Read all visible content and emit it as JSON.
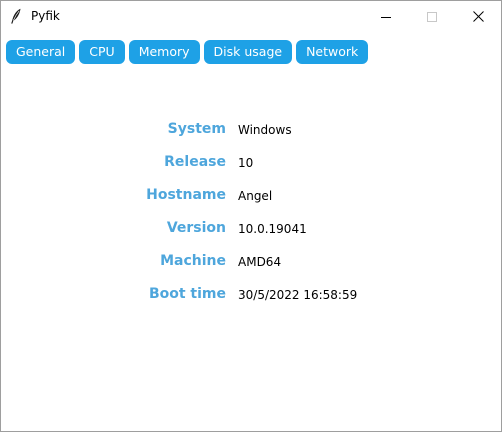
{
  "window": {
    "title": "Pyfik",
    "app_icon": "feather-icon",
    "controls": {
      "minimize_icon": "minimize-icon",
      "maximize_icon": "maximize-icon",
      "close_icon": "close-icon"
    }
  },
  "tabs": [
    {
      "label": "General"
    },
    {
      "label": "CPU"
    },
    {
      "label": "Memory"
    },
    {
      "label": "Disk usage"
    },
    {
      "label": "Network"
    }
  ],
  "system_info": [
    {
      "label": "System",
      "value": "Windows"
    },
    {
      "label": "Release",
      "value": "10"
    },
    {
      "label": "Hostname",
      "value": "Angel"
    },
    {
      "label": "Version",
      "value": "10.0.19041"
    },
    {
      "label": "Machine",
      "value": "AMD64"
    },
    {
      "label": "Boot time",
      "value": "30/5/2022 16:58:59"
    }
  ],
  "colors": {
    "tab_background": "#1ea1e6",
    "tab_text": "#ffffff",
    "label_text": "#4ea6dc",
    "value_text": "#000000"
  }
}
